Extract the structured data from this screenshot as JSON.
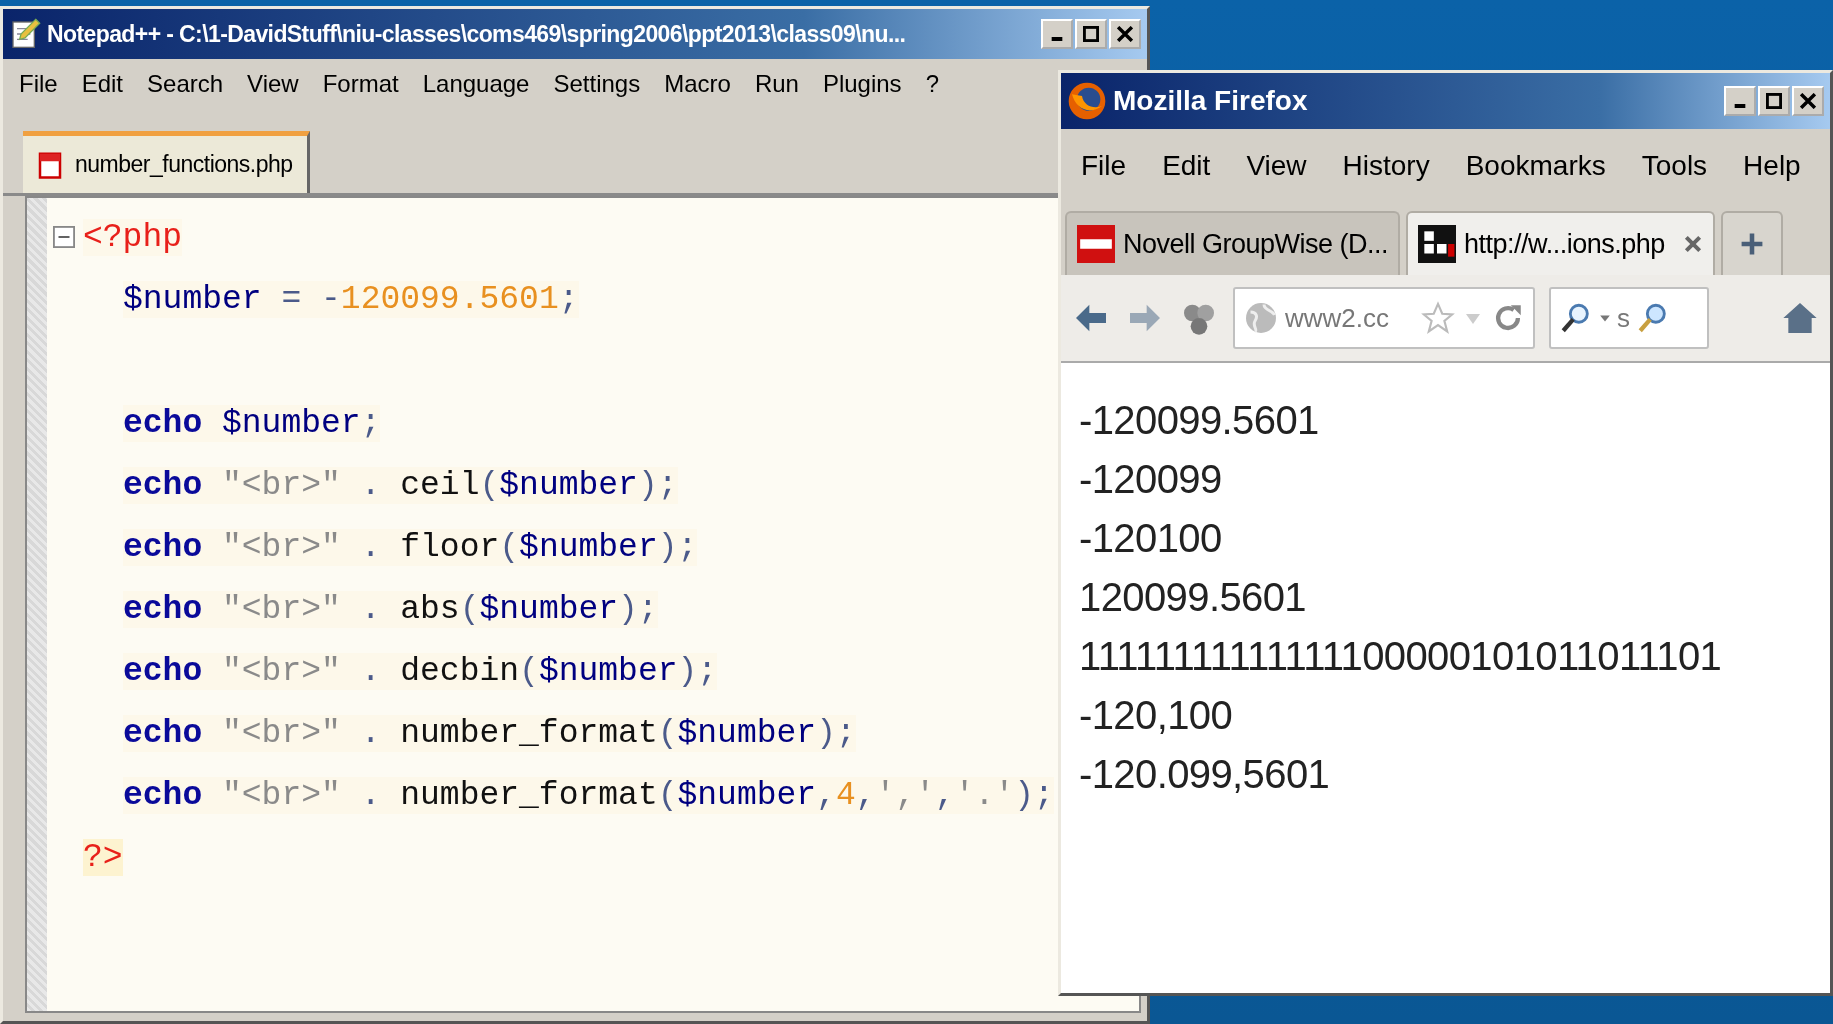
{
  "notepad": {
    "title": "Notepad++ - C:\\1-DavidStuff\\niu-classes\\coms469\\spring2006\\ppt2013\\class09\\nu...",
    "menu": [
      "File",
      "Edit",
      "Search",
      "View",
      "Format",
      "Language",
      "Settings",
      "Macro",
      "Run",
      "Plugins",
      "?"
    ],
    "tabs": [
      {
        "label": "number_functions.php",
        "selected": true
      }
    ],
    "code_lines": [
      {
        "kind": "open_tag",
        "expanded": true,
        "tokens": [
          {
            "kind": "tag",
            "text": "<?php"
          }
        ]
      },
      {
        "kind": "statement",
        "tokens": [
          {
            "kind": "variable",
            "text": "$number"
          },
          {
            "kind": "operator",
            "text": "=",
            "space_before": true
          },
          {
            "kind": "operator",
            "text": "-",
            "space_before": true
          },
          {
            "kind": "number",
            "text": "120099.5601"
          },
          {
            "kind": "operator",
            "text": ";"
          }
        ]
      },
      {
        "kind": "blank"
      },
      {
        "kind": "statement",
        "tokens": [
          {
            "kind": "keyword",
            "text": "echo"
          },
          {
            "kind": "variable",
            "text": "$number",
            "space_before": true
          },
          {
            "kind": "operator",
            "text": ";"
          }
        ]
      },
      {
        "kind": "statement",
        "tokens": [
          {
            "kind": "keyword",
            "text": "echo"
          },
          {
            "kind": "string",
            "text": "\"<br>\"",
            "space_before": true
          },
          {
            "kind": "operator",
            "text": ".",
            "space_before": true
          },
          {
            "kind": "function",
            "text": "ceil",
            "space_before": true
          },
          {
            "kind": "operator",
            "text": "("
          },
          {
            "kind": "variable",
            "text": "$number"
          },
          {
            "kind": "operator",
            "text": ");"
          }
        ]
      },
      {
        "kind": "statement",
        "tokens": [
          {
            "kind": "keyword",
            "text": "echo"
          },
          {
            "kind": "string",
            "text": "\"<br>\"",
            "space_before": true
          },
          {
            "kind": "operator",
            "text": ".",
            "space_before": true
          },
          {
            "kind": "function",
            "text": "floor",
            "space_before": true
          },
          {
            "kind": "operator",
            "text": "("
          },
          {
            "kind": "variable",
            "text": "$number"
          },
          {
            "kind": "operator",
            "text": ");"
          }
        ]
      },
      {
        "kind": "statement",
        "tokens": [
          {
            "kind": "keyword",
            "text": "echo"
          },
          {
            "kind": "string",
            "text": "\"<br>\"",
            "space_before": true
          },
          {
            "kind": "operator",
            "text": ".",
            "space_before": true
          },
          {
            "kind": "function",
            "text": "abs",
            "space_before": true
          },
          {
            "kind": "operator",
            "text": "("
          },
          {
            "kind": "variable",
            "text": "$number"
          },
          {
            "kind": "operator",
            "text": ");"
          }
        ]
      },
      {
        "kind": "statement",
        "tokens": [
          {
            "kind": "keyword",
            "text": "echo"
          },
          {
            "kind": "string",
            "text": "\"<br>\"",
            "space_before": true
          },
          {
            "kind": "operator",
            "text": ".",
            "space_before": true
          },
          {
            "kind": "function",
            "text": "decbin",
            "space_before": true
          },
          {
            "kind": "operator",
            "text": "("
          },
          {
            "kind": "variable",
            "text": "$number"
          },
          {
            "kind": "operator",
            "text": ");"
          }
        ]
      },
      {
        "kind": "statement",
        "tokens": [
          {
            "kind": "keyword",
            "text": "echo"
          },
          {
            "kind": "string",
            "text": "\"<br>\"",
            "space_before": true
          },
          {
            "kind": "operator",
            "text": ".",
            "space_before": true
          },
          {
            "kind": "function",
            "text": "number_format",
            "space_before": true
          },
          {
            "kind": "operator",
            "text": "("
          },
          {
            "kind": "variable",
            "text": "$number"
          },
          {
            "kind": "operator",
            "text": ");"
          }
        ]
      },
      {
        "kind": "statement",
        "tokens": [
          {
            "kind": "keyword",
            "text": "echo"
          },
          {
            "kind": "string",
            "text": "\"<br>\"",
            "space_before": true
          },
          {
            "kind": "operator",
            "text": ".",
            "space_before": true
          },
          {
            "kind": "function",
            "text": "number_format",
            "space_before": true
          },
          {
            "kind": "operator",
            "text": "("
          },
          {
            "kind": "variable",
            "text": "$number"
          },
          {
            "kind": "operator",
            "text": ","
          },
          {
            "kind": "number",
            "text": "4"
          },
          {
            "kind": "operator",
            "text": ","
          },
          {
            "kind": "string",
            "text": "','"
          },
          {
            "kind": "operator",
            "text": ","
          },
          {
            "kind": "string",
            "text": "'.'"
          },
          {
            "kind": "operator",
            "text": ");"
          }
        ]
      },
      {
        "kind": "close_tag",
        "tokens": [
          {
            "kind": "tag",
            "text": "?>"
          }
        ]
      }
    ]
  },
  "firefox": {
    "title": "Mozilla Firefox",
    "menu": [
      "File",
      "Edit",
      "View",
      "History",
      "Bookmarks",
      "Tools",
      "Help"
    ],
    "tabs": [
      {
        "label": "Novell GroupWise (D...",
        "selected": false
      },
      {
        "label": "http://w...ions.php",
        "selected": true
      }
    ],
    "address": "www2.cc",
    "search": "s",
    "output_lines": [
      "-120099.5601",
      "-120099",
      "-120100",
      "120099.5601",
      "11111111111111100000101011011101",
      "-120,100",
      "-120.099,5601"
    ]
  }
}
